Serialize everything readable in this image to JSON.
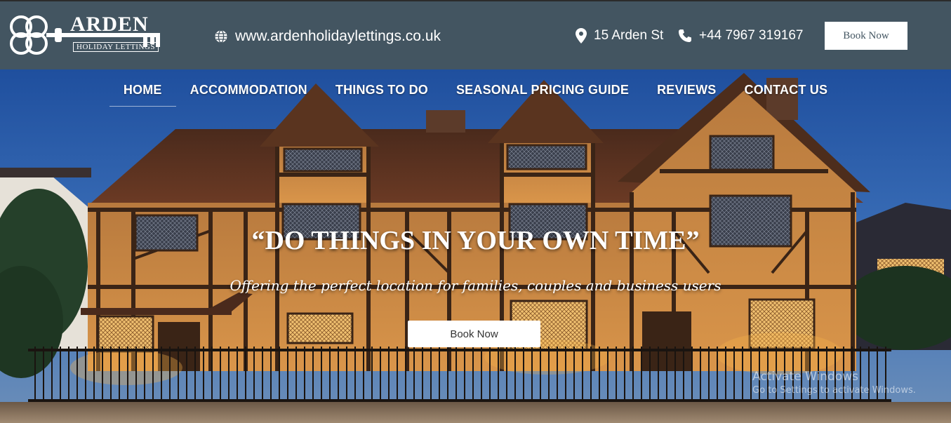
{
  "header": {
    "logo": {
      "name": "ARDEN",
      "subtitle": "HOLIDAY LETTINGS"
    },
    "website": {
      "icon": "globe-icon",
      "text": "www.ardenholidaylettings.co.uk"
    },
    "address": {
      "icon": "map-pin-icon",
      "text": "15 Arden St"
    },
    "phone": {
      "icon": "phone-icon",
      "text": "+44 7967 319167"
    },
    "book_button": "Book Now"
  },
  "nav": {
    "items": [
      {
        "label": "HOME",
        "active": true
      },
      {
        "label": "ACCOMMODATION"
      },
      {
        "label": "THINGS TO DO"
      },
      {
        "label": "SEASONAL PRICING GUIDE"
      },
      {
        "label": "REVIEWS"
      },
      {
        "label": "CONTACT US"
      }
    ]
  },
  "hero": {
    "headline": "“DO THINGS IN YOUR OWN TIME”",
    "subline": "Offering the perfect location for families, couples and business users",
    "book_button": "Book Now"
  },
  "watermark": {
    "title": "Activate Windows",
    "subtitle": "Go to Settings to activate Windows."
  },
  "colors": {
    "header_bg": "#435561",
    "sky": "#2e5ea8",
    "timber": "#4a2e1c",
    "plaster": "#c8843e",
    "window_glow": "#f5c060"
  }
}
